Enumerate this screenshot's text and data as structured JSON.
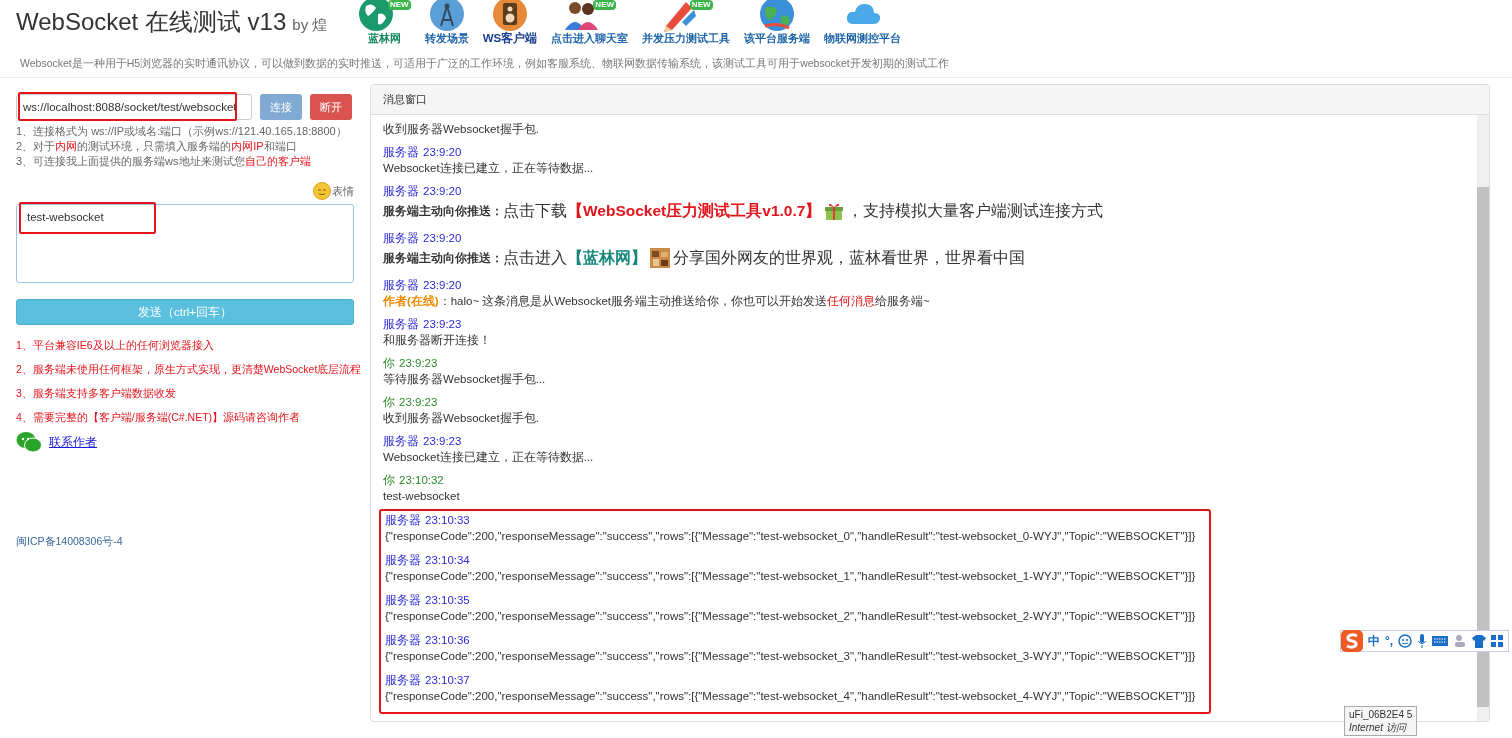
{
  "header": {
    "title": "WebSocket 在线测试 v13",
    "byline": "by 煌",
    "nav": [
      {
        "label": "蓝林网",
        "kind": "globe",
        "badge": "NEW",
        "selected": false,
        "color": "#14875e"
      },
      {
        "label": "转发场景",
        "kind": "antenna",
        "selected": false,
        "color": "#1d63a8"
      },
      {
        "label": "WS客户端",
        "kind": "speaker",
        "selected": true,
        "color": "#1b3f8f"
      },
      {
        "label": "点击进入聊天室",
        "kind": "people",
        "badge": "NEW",
        "selected": false,
        "color": "#1d63a8"
      },
      {
        "label": "并发压力测试工具",
        "kind": "pencil",
        "badge": "NEW",
        "selected": false,
        "color": "#1d63a8"
      },
      {
        "label": "该平台服务端",
        "kind": "earth",
        "selected": false,
        "color": "#1d63a8"
      },
      {
        "label": "物联网测控平台",
        "kind": "cloud",
        "selected": false,
        "color": "#1d63a8"
      }
    ],
    "description": "Websocket是一种用于H5浏览器的实时通讯协议，可以做到数据的实时推送，可适用于广泛的工作环境，例如客服系统、物联网数据传输系统，该测试工具可用于websocket开发初期的测试工作"
  },
  "connection": {
    "url": "ws://localhost:8088/socket/test/websocket",
    "annotated": true,
    "buttons": [
      {
        "label": "连接",
        "kind": "connect",
        "disabled": true
      },
      {
        "label": "断开",
        "kind": "disconnect",
        "disabled": false
      }
    ]
  },
  "hints": [
    {
      "parts": [
        {
          "text": "1、连接格式为 ws://IP或域名:端口（示例ws://121.40.165.18:8800）",
          "highlight": false
        }
      ]
    },
    {
      "parts": [
        {
          "text": "2、对于",
          "highlight": false
        },
        {
          "text": "内网",
          "highlight": true
        },
        {
          "text": "的测试环境，只需填入服务端的",
          "highlight": false
        },
        {
          "text": "内网IP",
          "highlight": true
        },
        {
          "text": "和端口",
          "highlight": false
        }
      ]
    },
    {
      "parts": [
        {
          "text": "3、可连接我上面提供的服务端ws地址来测试您",
          "highlight": false
        },
        {
          "text": "自己的客户端",
          "highlight": true
        }
      ]
    }
  ],
  "emoji_button": "表情",
  "message_input": {
    "value": "test-websocket",
    "annotated": true
  },
  "send_button": "发送（ctrl+回车）",
  "notes": [
    "1、平台兼容IE6及以上的任何浏览器接入",
    "2、服务端未使用任何框架，原生方式实现，更清楚WebSocket底层流程",
    "3、服务端支持多客户端数据收发",
    "4、需要完整的【客户端/服务端(C#.NET)】源码请咨询作者"
  ],
  "contact_link": "联系作者",
  "icp": "闽ICP备14008306号-4",
  "message_window": {
    "title": "消息窗口",
    "messages": [
      {
        "kind": "text",
        "body": "收到服务器Websocket握手包.",
        "boxed": false
      },
      {
        "kind": "text",
        "color": "#2a2ad8",
        "sender": "服务器",
        "time": "23:9:20",
        "body": "Websocket连接已建立，正在等待数据...",
        "boxed": false
      },
      {
        "kind": "download",
        "color": "#2a2ad8",
        "sender": "服务器",
        "time": "23:9:20",
        "label": "服务端主动向你推送：",
        "before": "点击下载",
        "link": {
          "text": "【WebSocket压力测试工具v1.0.7】",
          "color": "#e4141b"
        },
        "after": "，支持模拟大量客户端测试连接方式",
        "boxed": false
      },
      {
        "kind": "visit",
        "color": "#2a2ad8",
        "sender": "服务器",
        "time": "23:9:20",
        "label": "服务端主动向你推送：",
        "before": "点击进入",
        "link": {
          "text": "【蓝林网】",
          "color": "#16877a"
        },
        "after": "分享国外网友的世界观，蓝林看世界，世界看中国",
        "boxed": false
      },
      {
        "kind": "author",
        "color": "#2a2ad8",
        "sender": "服务器",
        "time": "23:9:20",
        "author": "作者(在线)",
        "parts": [
          {
            "text": "：halo~ 这条消息是从Websocket服务端主动推送给你，你也可以开始发送",
            "highlight": false
          },
          {
            "text": "任何消息",
            "highlight": true
          },
          {
            "text": "给服务端~",
            "highlight": false
          }
        ],
        "boxed": false
      },
      {
        "kind": "text",
        "color": "#2a2ad8",
        "sender": "服务器",
        "time": "23:9:23",
        "body": "和服务器断开连接！",
        "boxed": false
      },
      {
        "kind": "text",
        "color": "#2e8b2e",
        "sender": "你",
        "time": "23:9:23",
        "body": "等待服务器Websocket握手包...",
        "boxed": false
      },
      {
        "kind": "text",
        "color": "#2e8b2e",
        "sender": "你",
        "time": "23:9:23",
        "body": "收到服务器Websocket握手包.",
        "boxed": false
      },
      {
        "kind": "text",
        "color": "#2a2ad8",
        "sender": "服务器",
        "time": "23:9:23",
        "body": "Websocket连接已建立，正在等待数据...",
        "boxed": false
      },
      {
        "kind": "text",
        "color": "#2e8b2e",
        "sender": "你",
        "time": "23:10:32",
        "body": "test-websocket",
        "boxed": false
      },
      {
        "kind": "text",
        "color": "#2a2ad8",
        "sender": "服务器",
        "time": "23:10:33",
        "body": "{\"responseCode\":200,\"responseMessage\":\"success\",\"rows\":[{\"Message\":\"test-websocket_0\",\"handleResult\":\"test-websocket_0-WYJ\",\"Topic\":\"WEBSOCKET\"}]}",
        "boxed": true
      },
      {
        "kind": "text",
        "color": "#2a2ad8",
        "sender": "服务器",
        "time": "23:10:34",
        "body": "{\"responseCode\":200,\"responseMessage\":\"success\",\"rows\":[{\"Message\":\"test-websocket_1\",\"handleResult\":\"test-websocket_1-WYJ\",\"Topic\":\"WEBSOCKET\"}]}",
        "boxed": true
      },
      {
        "kind": "text",
        "color": "#2a2ad8",
        "sender": "服务器",
        "time": "23:10:35",
        "body": "{\"responseCode\":200,\"responseMessage\":\"success\",\"rows\":[{\"Message\":\"test-websocket_2\",\"handleResult\":\"test-websocket_2-WYJ\",\"Topic\":\"WEBSOCKET\"}]}",
        "boxed": true
      },
      {
        "kind": "text",
        "color": "#2a2ad8",
        "sender": "服务器",
        "time": "23:10:36",
        "body": "{\"responseCode\":200,\"responseMessage\":\"success\",\"rows\":[{\"Message\":\"test-websocket_3\",\"handleResult\":\"test-websocket_3-WYJ\",\"Topic\":\"WEBSOCKET\"}]}",
        "boxed": true
      },
      {
        "kind": "text",
        "color": "#2a2ad8",
        "sender": "服务器",
        "time": "23:10:37",
        "body": "{\"responseCode\":200,\"responseMessage\":\"success\",\"rows\":[{\"Message\":\"test-websocket_4\",\"handleResult\":\"test-websocket_4-WYJ\",\"Topic\":\"WEBSOCKET\"}]}",
        "boxed": true
      }
    ]
  },
  "ime_toolbar": {
    "mode": "中",
    "punctuation": "°,"
  },
  "tooltip": {
    "line_1": "uFi_06B2E4 5",
    "line_2": "Internet 访问"
  }
}
